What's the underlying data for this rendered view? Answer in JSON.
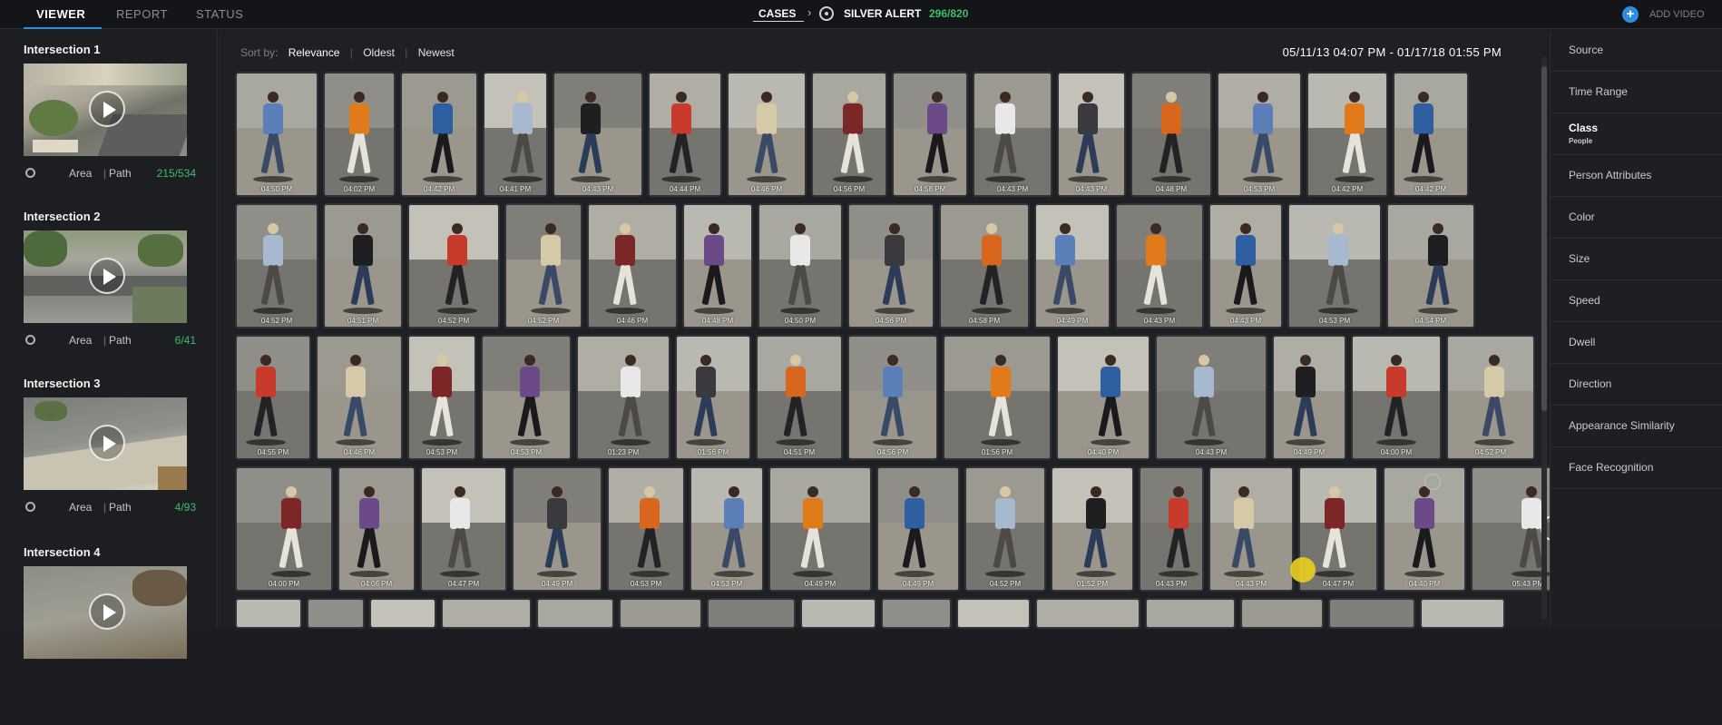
{
  "topbar": {
    "tabs": [
      "VIEWER",
      "REPORT",
      "STATUS"
    ],
    "crumb_cases": "CASES",
    "crumb_sep": "›",
    "crumb_alert": "SILVER ALERT",
    "crumb_count": "296/820",
    "add_video": "ADD VIDEO",
    "add_icon": "+"
  },
  "sidebar": {
    "cameras": [
      {
        "title": "Intersection 1",
        "area": "Area",
        "path": "Path",
        "count": "215/534"
      },
      {
        "title": "Intersection 2",
        "area": "Area",
        "path": "Path",
        "count": "6/41"
      },
      {
        "title": "Intersection 3",
        "area": "Area",
        "path": "Path",
        "count": "4/93"
      },
      {
        "title": "Intersection 4"
      }
    ],
    "pipe": "|"
  },
  "main": {
    "sort_label": "Sort by:",
    "sort_options": [
      "Relevance",
      "Oldest",
      "Newest"
    ],
    "pipe": "|",
    "date_range": "05/11/13 04:07 PM - 01/17/18 01:55 PM"
  },
  "results": {
    "rows": [
      [
        "04:50 PM",
        "04:02 PM",
        "04:42 PM",
        "04:41 PM",
        "04:43 PM",
        "04:44 PM",
        "04:46 PM",
        "04:56 PM",
        "04:58 PM",
        "04:43 PM",
        "04:43 PM",
        "04:48 PM",
        "04:53 PM",
        "04:42 PM",
        "04:42 PM"
      ],
      [
        "04:52 PM",
        "04:51 PM",
        "04:52 PM",
        "04:52 PM",
        "04:46 PM",
        "04:48 PM",
        "04:50 PM",
        "04:56 PM",
        "04:58 PM",
        "04:49 PM",
        "04:43 PM",
        "04:43 PM",
        "04:53 PM",
        "04:54 PM"
      ],
      [
        "04:55 PM",
        "04:46 PM",
        "04:53 PM",
        "04:53 PM",
        "01:23 PM",
        "01:56 PM",
        "04:51 PM",
        "04:56 PM",
        "01:56 PM",
        "04:40 PM",
        "04:43 PM",
        "04:49 PM",
        "04:00 PM",
        "04:52 PM"
      ],
      [
        "04:00 PM",
        "04:06 PM",
        "04:47 PM",
        "04:49 PM",
        "04:53 PM",
        "04:53 PM",
        "04:49 PM",
        "04:49 PM",
        "04:52 PM",
        "01:52 PM",
        "04:43 PM",
        "04:43 PM",
        "04:47 PM",
        "04:40 PM",
        "05:43 PM"
      ]
    ]
  },
  "filters": {
    "items": [
      "Source",
      "Time Range",
      "Class",
      "Person Attributes",
      "Color",
      "Size",
      "Speed",
      "Dwell",
      "Direction",
      "Appearance Similarity",
      "Face Recognition"
    ],
    "class_value": "People"
  }
}
